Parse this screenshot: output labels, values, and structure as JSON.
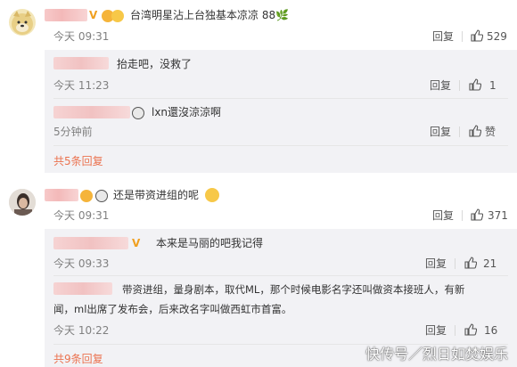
{
  "comments": [
    {
      "text": "台湾明星沾上台独基本凉凉 88🌿",
      "time": "今天 09:31",
      "reply_label": "回复",
      "likes": "529",
      "replies": [
        {
          "text": "抬走吧，没救了",
          "time": "今天 11:23",
          "reply_label": "回复",
          "likes": "1"
        },
        {
          "text": "lxn還沒涼涼啊",
          "time": "5分钟前",
          "reply_label": "回复",
          "likes": "赞"
        }
      ],
      "more_label": "共5条回复"
    },
    {
      "text": "还是带资进组的呢",
      "time": "今天 09:31",
      "reply_label": "回复",
      "likes": "371",
      "replies": [
        {
          "text": "本来是马丽的吧我记得",
          "time": "今天 09:33",
          "reply_label": "回复",
          "likes": "21"
        },
        {
          "text_line1": "带资进组，量身剧本，取代ML，那个时候电影名字还叫做资本接班人，有新",
          "text_line2": "闻，ml出席了发布会，后来改名字叫做西虹市首富。",
          "time": "今天 10:22",
          "reply_label": "回复",
          "likes": "16"
        }
      ],
      "more_label": "共9条回复"
    }
  ],
  "watermark": "快传号／烈日如焚娱乐",
  "badge_v": "V",
  "colors": {
    "accent_orange": "#eb7350",
    "reply_bg": "#f2f2f5",
    "vip_gold": "#f0a020"
  }
}
